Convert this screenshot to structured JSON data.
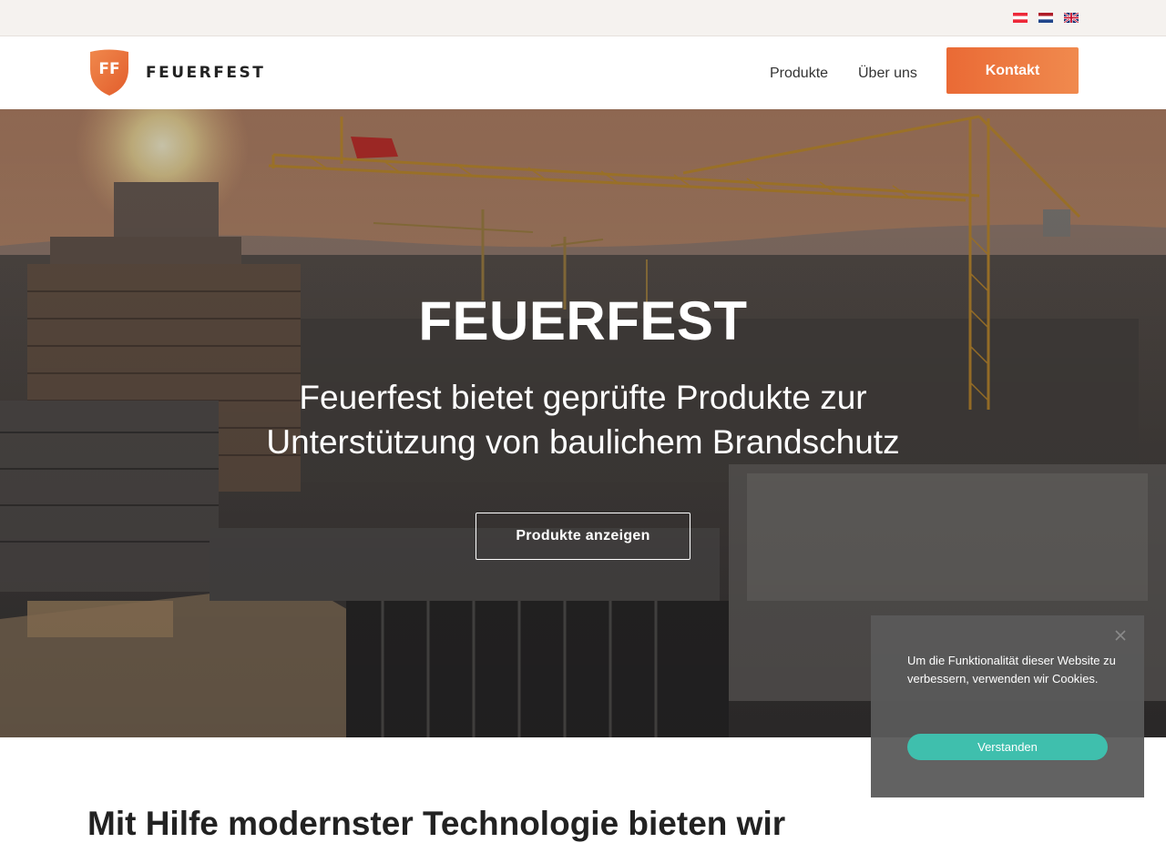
{
  "topbar": {
    "languages": [
      {
        "icon": "flag-austria-icon",
        "colors": [
          "#ed2939",
          "#ffffff",
          "#ed2939"
        ]
      },
      {
        "icon": "flag-netherlands-icon",
        "colors": [
          "#ae1c28",
          "#ffffff",
          "#21468b"
        ]
      },
      {
        "icon": "flag-uk-icon",
        "colors": [
          "#012169",
          "#ffffff",
          "#c8102e"
        ]
      }
    ]
  },
  "header": {
    "logo_monogram": "FF",
    "logo_text": "FEUERFEST",
    "nav": {
      "produkte": "Produkte",
      "ueber_uns": "Über uns"
    },
    "cta_label": "Kontakt"
  },
  "hero": {
    "title": "FEUERFEST",
    "subtitle": "Feuerfest bietet geprüfte Produkte zur Unterstützung von baulichem Brandschutz",
    "button_label": "Produkte anzeigen"
  },
  "content": {
    "heading": "Mit Hilfe modernster Technologie bieten wir"
  },
  "cookie_banner": {
    "text": "Um die Funktionalität dieser Website zu verbessern, verwenden wir Cookies.",
    "button_label": "Verstanden"
  },
  "colors": {
    "brand_orange": "#ec6d38",
    "topbar_bg": "#f5f2ef",
    "cookie_button": "#3fbfad",
    "cookie_bg": "#5a5a5a"
  }
}
